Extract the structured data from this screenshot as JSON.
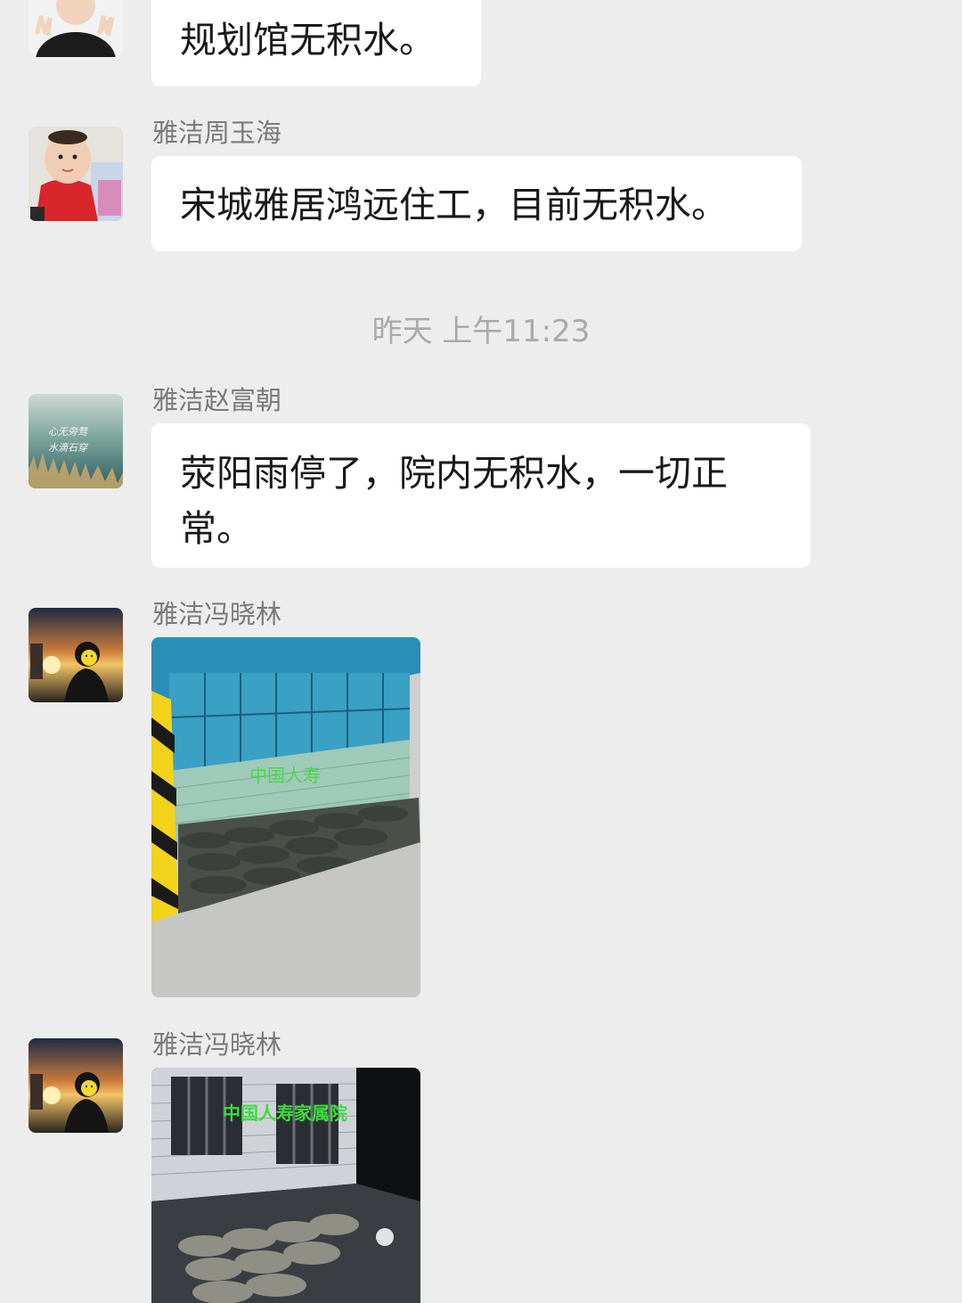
{
  "messages": [
    {
      "sender": "",
      "avatar": "avatar-peace-sign-person",
      "text": "规划馆无积水。"
    },
    {
      "sender": "雅洁周玉海",
      "avatar": "avatar-baby-red-shirt",
      "text": "宋城雅居鸿远住工，目前无积水。"
    },
    {
      "sender": "雅洁赵富朝",
      "avatar": "avatar-sea-calligraphy",
      "avatar_text": "心无旁骛 水滴石穿",
      "text_line1": "荥阳雨停了，院内无积水，一切正",
      "text_line2": "常。"
    },
    {
      "sender": "雅洁冯晓林",
      "avatar": "avatar-sunset-silhouette",
      "photo": "photo-sandbags-canopy",
      "photo_watermark": "中国人寿"
    },
    {
      "sender": "雅洁冯晓林",
      "avatar": "avatar-sunset-silhouette",
      "photo": "photo-sandbags-night",
      "photo_watermark": "中国人寿家属院"
    }
  ],
  "timestamp": "昨天 上午11:23",
  "colors": {
    "background": "#ededed",
    "bubble": "#ffffff",
    "sender_name": "#7a7a7a",
    "timestamp": "#aaaaaa",
    "watermark_green": "#3ddc3d"
  }
}
